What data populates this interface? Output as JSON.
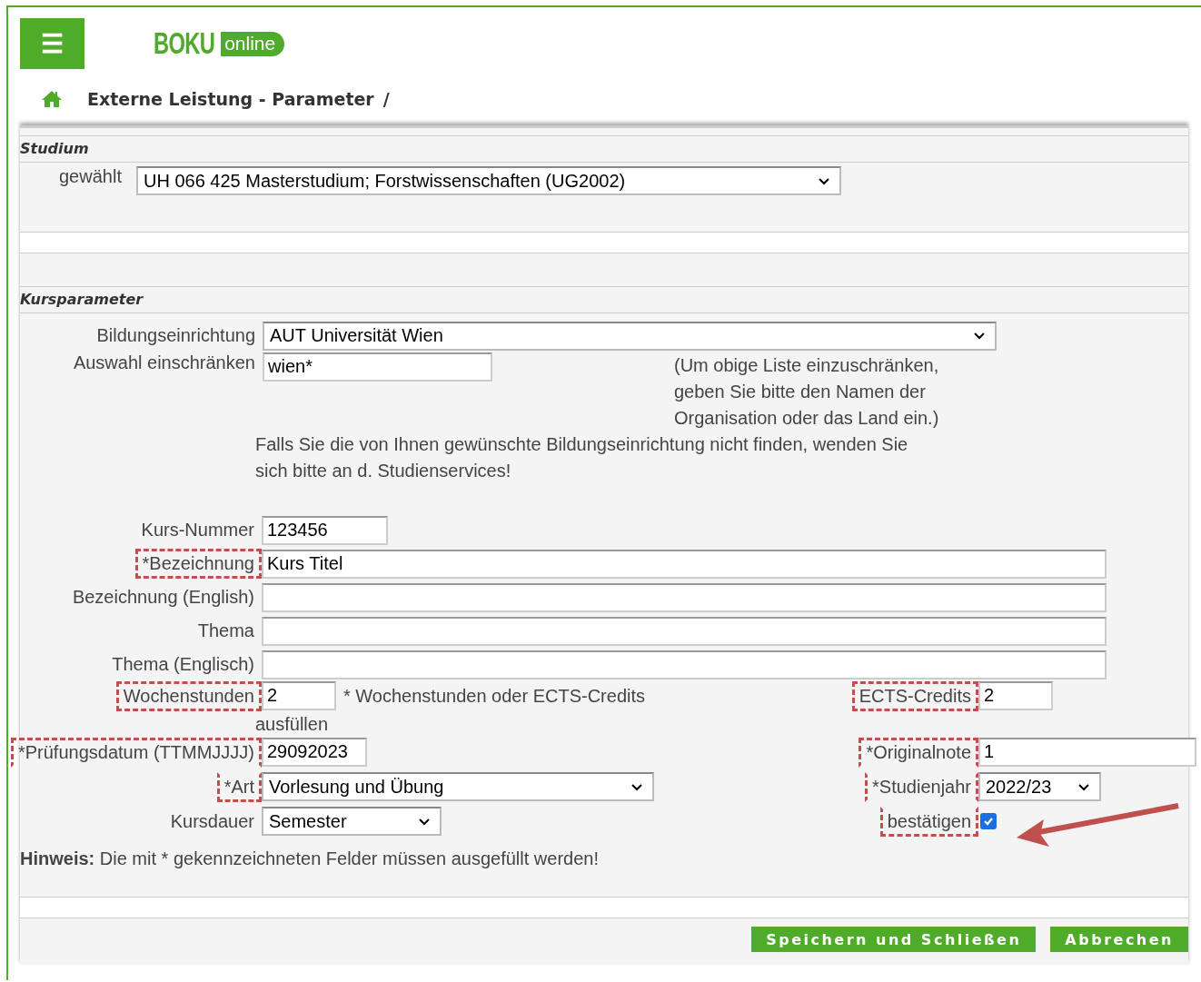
{
  "header": {
    "menu_icon": "☰",
    "logo": {
      "main": "BOKU",
      "badge": "online"
    },
    "title": "Externe Leistung - Parameter",
    "separator": "/"
  },
  "studium": {
    "heading": "Studium",
    "label": "gewählt",
    "value": "UH 066 425 Masterstudium; Forstwissenschaften (UG2002)"
  },
  "kursparameter": {
    "heading": "Kursparameter",
    "institution": {
      "label": "Bildungseinrichtung",
      "value": "AUT Universität Wien"
    },
    "filter": {
      "label": "Auswahl einschränken",
      "value": "wien*",
      "hint": "(Um obige Liste einzuschränken, geben Sie bitte den Namen der Organisation oder das Land ein.)"
    },
    "notice": "Falls Sie die von Ihnen gewünschte Bildungseinrichtung nicht finden, wenden Sie sich bitte an d. Studienservices!",
    "fields": [
      {
        "kind": "short",
        "label": "Kurs-Nummer",
        "value": "123456",
        "highlighted": false
      },
      {
        "kind": "wide",
        "label": "*Bezeichnung",
        "value": "Kurs Titel",
        "highlighted": true
      },
      {
        "kind": "wide",
        "label": "Bezeichnung (English)",
        "highlighted": false
      },
      {
        "kind": "wide",
        "label": "Thema",
        "highlighted": false
      },
      {
        "kind": "wide",
        "label": "Thema (Englisch)",
        "highlighted": false
      }
    ],
    "pairs": [
      {
        "left": {
          "kind": "tiny",
          "label": "Wochenstunden",
          "value": "2",
          "note_lines": [
            "* Wochenstunden oder ECTS-Credits",
            "ausfüllen"
          ],
          "highlighted": true
        },
        "right": {
          "kind": "tiny",
          "label": "ECTS-Credits",
          "value": "2",
          "highlighted": true
        }
      },
      {
        "left": {
          "kind": "date",
          "label": "*Prüfungsdatum (TTMMJJJJ)",
          "value": "29092023",
          "highlighted": true
        },
        "right": {
          "kind": "open",
          "label": "*Originalnote",
          "value": "1",
          "highlighted": true
        }
      },
      {
        "left": {
          "kind": "select",
          "label": "*Art",
          "value": "Vorlesung und Übung",
          "highlighted": true
        },
        "right": {
          "kind": "select",
          "label": "*Studienjahr",
          "value": "2022/23",
          "highlighted": true
        }
      },
      {
        "left": {
          "kind": "smallselect",
          "label": "Kursdauer",
          "value": "Semester",
          "highlighted": false
        },
        "right": {
          "kind": "checkbox",
          "label": "bestätigen",
          "checked": true,
          "highlighted": true,
          "arrow": true
        }
      }
    ],
    "hint": "**Hinweis:** Die mit * gekennzeichneten Felder müssen ausgefüllt werden!"
  },
  "buttons": [
    "Speichern und Schließen",
    "Abbrechen"
  ]
}
